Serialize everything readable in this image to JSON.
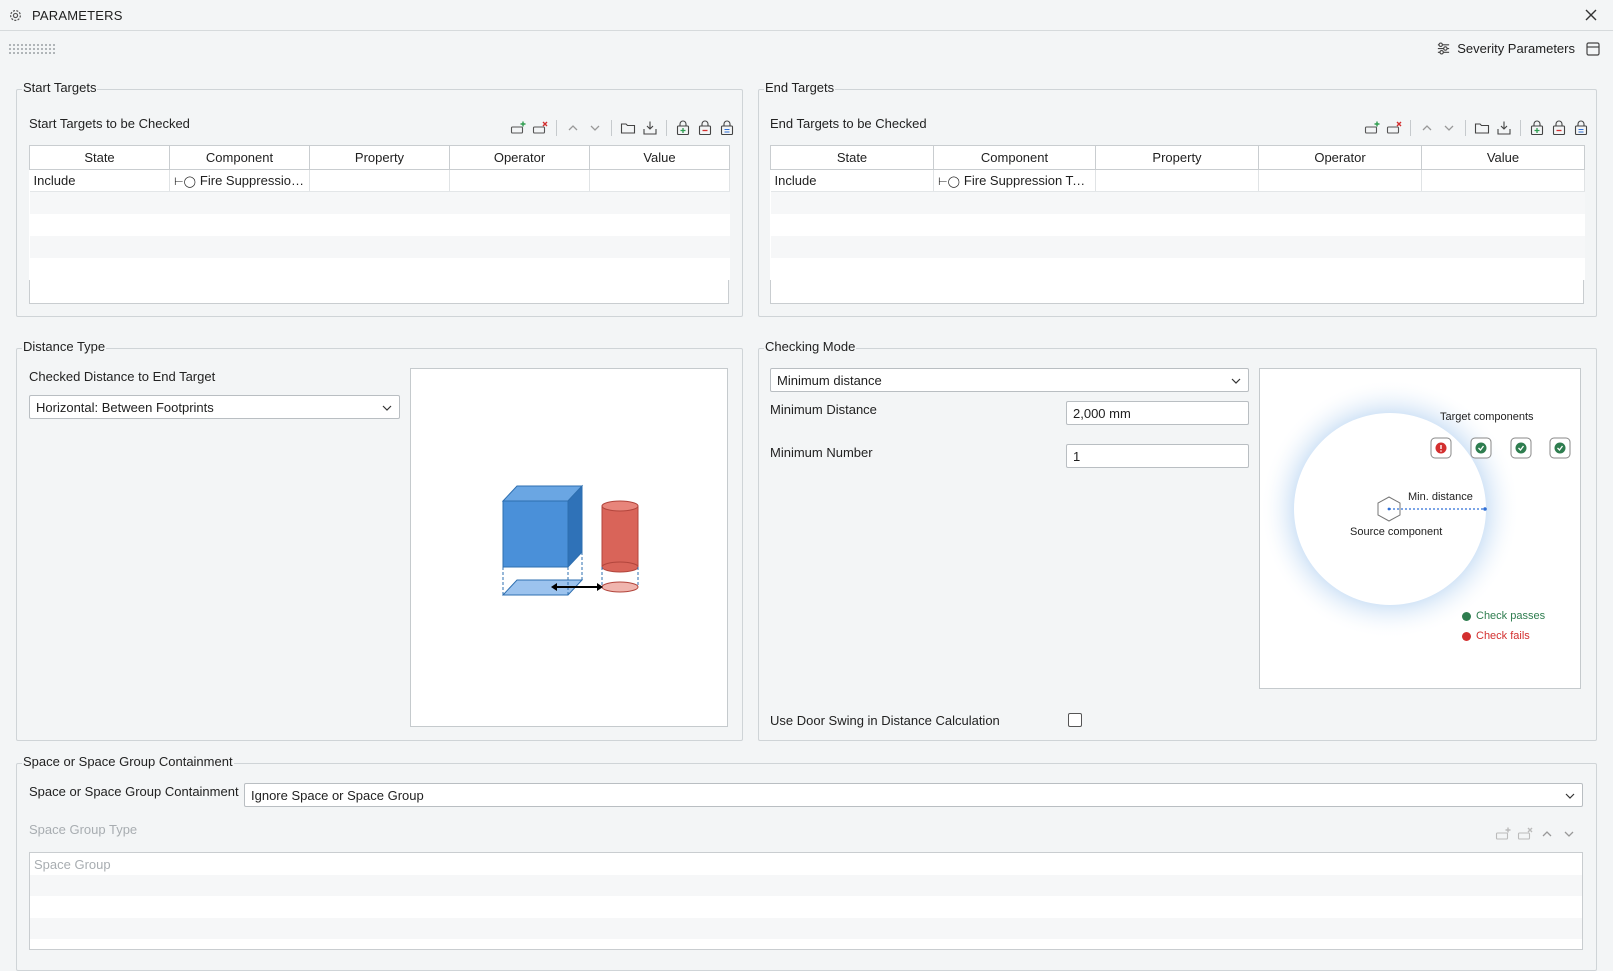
{
  "window": {
    "title": "PARAMETERS",
    "severity_label": "Severity Parameters"
  },
  "start_targets": {
    "group_label": "Start Targets",
    "sub_label": "Start Targets to be Checked",
    "columns": [
      "State",
      "Component",
      "Property",
      "Operator",
      "Value"
    ],
    "rows": [
      {
        "state": "Include",
        "component": "Fire Suppression ...",
        "property": "",
        "operator": "",
        "value": ""
      }
    ]
  },
  "end_targets": {
    "group_label": "End Targets",
    "sub_label": "End Targets to be Checked",
    "columns": [
      "State",
      "Component",
      "Property",
      "Operator",
      "Value"
    ],
    "rows": [
      {
        "state": "Include",
        "component": "Fire Suppression Ter...",
        "property": "",
        "operator": "",
        "value": ""
      }
    ]
  },
  "distance_type": {
    "group_label": "Distance Type",
    "field_label": "Checked Distance to End Target",
    "selected": "Horizontal: Between Footprints"
  },
  "checking_mode": {
    "group_label": "Checking Mode",
    "mode_selected": "Minimum distance",
    "min_distance_label": "Minimum Distance",
    "min_distance_value": "2,000 mm",
    "min_number_label": "Minimum Number",
    "min_number_value": "1",
    "door_swing_label": "Use Door Swing in Distance Calculation",
    "door_swing_checked": false,
    "diagram": {
      "target_label": "Target components",
      "min_distance_label": "Min. distance",
      "source_label": "Source component",
      "legend_pass": "Check passes",
      "legend_fail": "Check fails",
      "colors": {
        "pass": "#2e7d4f",
        "fail": "#d32f2f",
        "accent": "#2f6fd6"
      }
    }
  },
  "space_containment": {
    "group_label": "Space or Space Group Containment",
    "field_label": "Space or Space Group Containment",
    "selected": "Ignore Space or Space Group",
    "type_label": "Space Group Type",
    "list_header": "Space Group"
  },
  "icons": [
    "gear-icon",
    "close-icon",
    "severity-settings-icon",
    "layout-icon",
    "add-row-icon",
    "remove-row-icon",
    "move-up-icon",
    "move-down-icon",
    "open-folder-icon",
    "import-icon",
    "lock-add-icon",
    "lock-remove-icon",
    "lock-clear-icon",
    "chevron-down-icon",
    "checkbox-icon"
  ]
}
